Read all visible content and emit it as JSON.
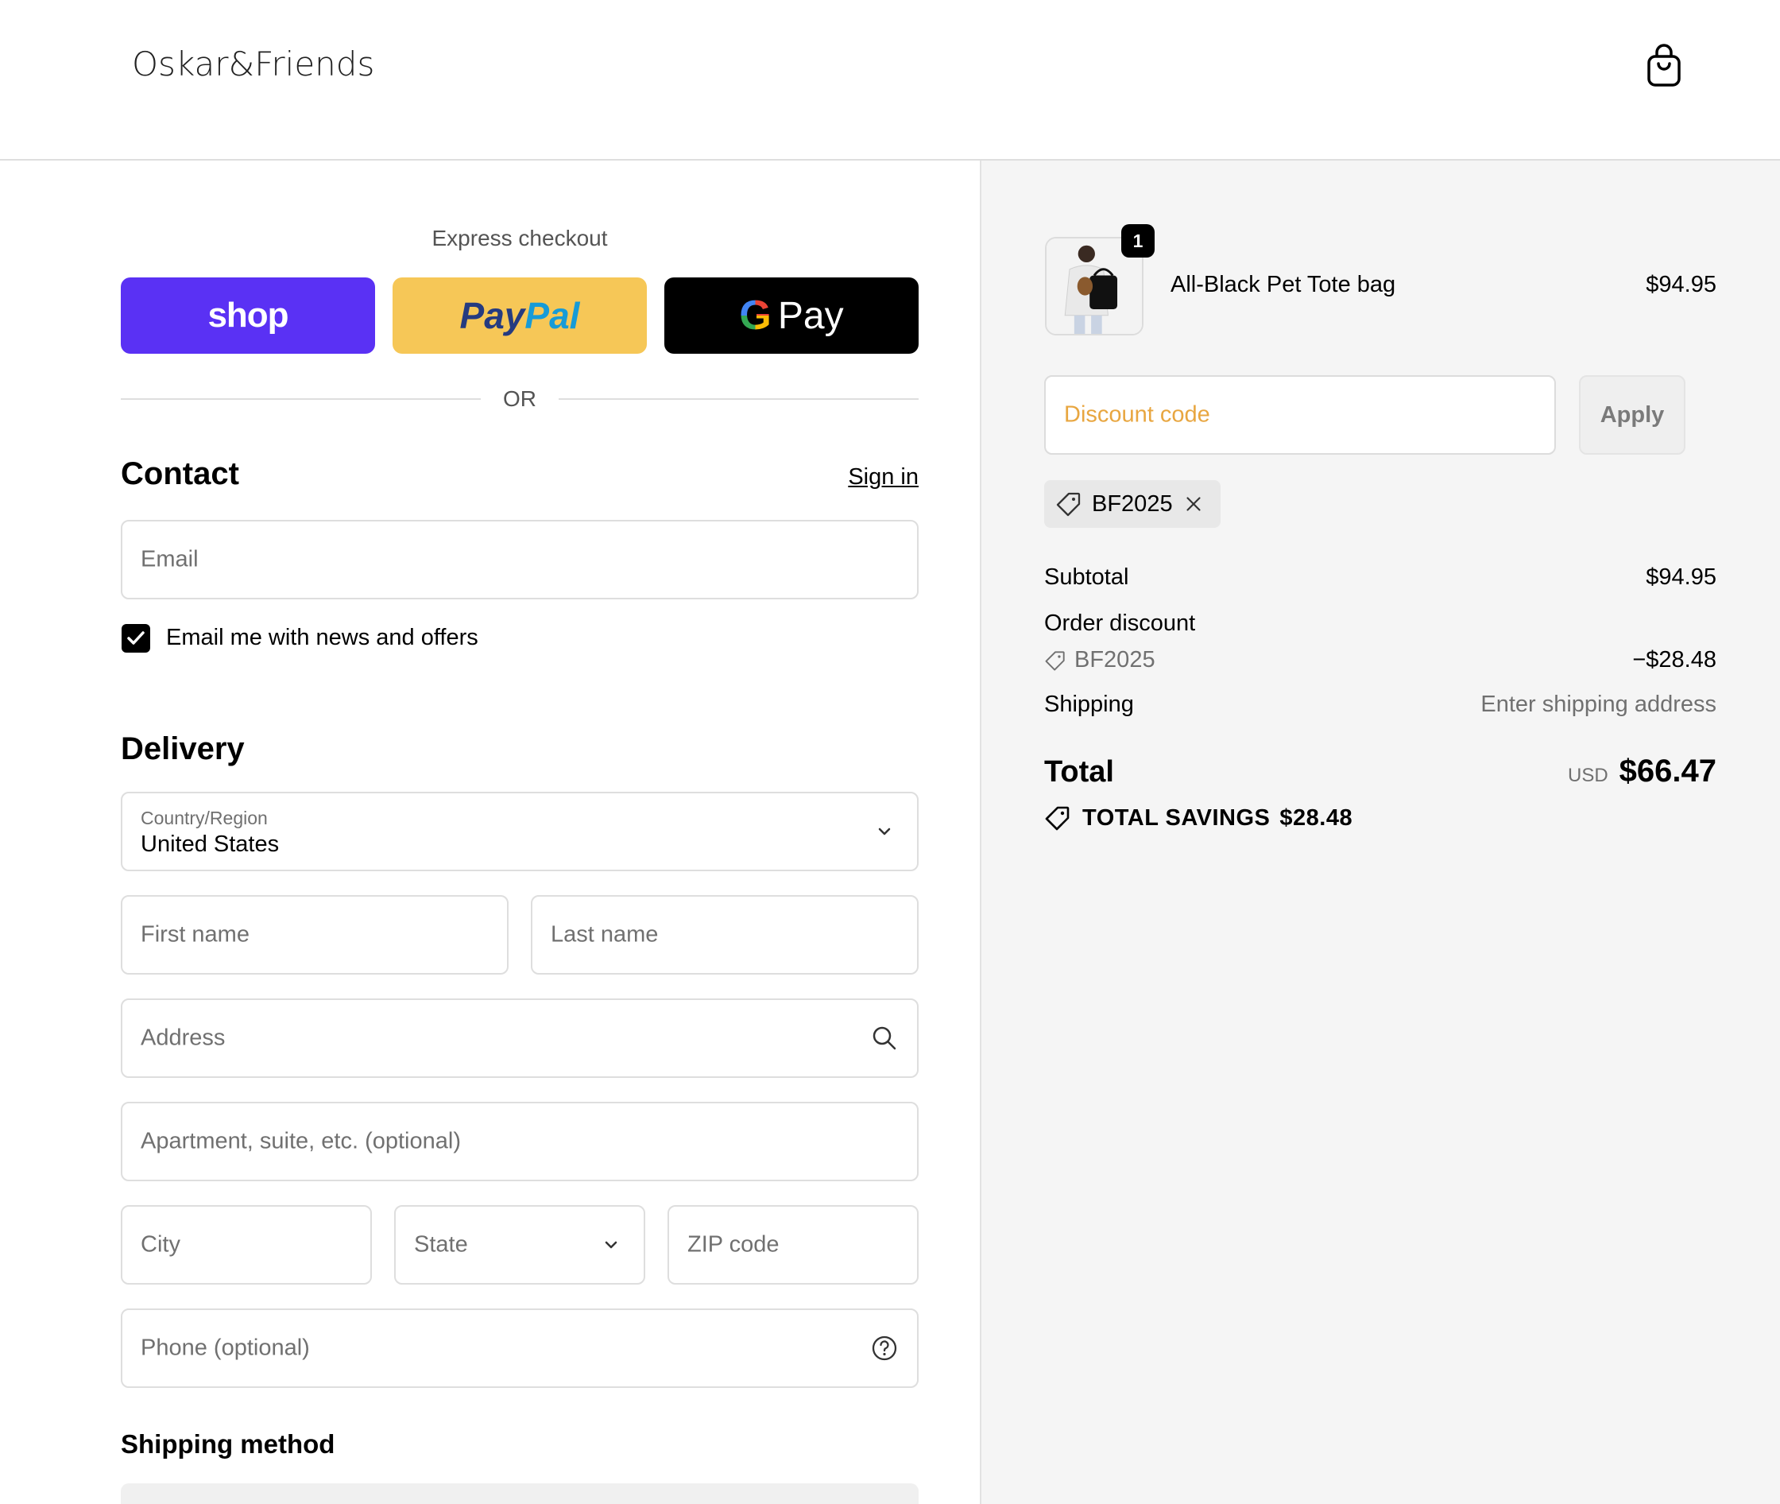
{
  "header": {
    "logo_text": "Oskar&Friends",
    "cart_icon": "shopping-bag-icon"
  },
  "express": {
    "title": "Express checkout",
    "shop_label": "shop",
    "paypal_label_1": "Pay",
    "paypal_label_2": "Pal",
    "gpay_g": "G",
    "gpay_label": "Pay",
    "or_label": "OR"
  },
  "contact": {
    "heading": "Contact",
    "sign_in": "Sign in",
    "email_placeholder": "Email",
    "news_label": "Email me with news and offers",
    "news_checked": true
  },
  "delivery": {
    "heading": "Delivery",
    "country_label": "Country/Region",
    "country_value": "United States",
    "first_name": "First name",
    "last_name": "Last name",
    "address": "Address",
    "apartment": "Apartment, suite, etc. (optional)",
    "city": "City",
    "state": "State",
    "zip": "ZIP code",
    "phone": "Phone (optional)"
  },
  "shipping_method": {
    "heading": "Shipping method"
  },
  "summary": {
    "product": {
      "name": "All-Black Pet Tote bag",
      "price": "$94.95",
      "quantity": "1"
    },
    "discount_placeholder": "Discount code",
    "apply_label": "Apply",
    "applied_code": "BF2025",
    "subtotal_label": "Subtotal",
    "subtotal_value": "$94.95",
    "order_discount_label": "Order discount",
    "order_discount_code": "BF2025",
    "order_discount_value": "−$28.48",
    "shipping_label": "Shipping",
    "shipping_value": "Enter shipping address",
    "total_label": "Total",
    "total_currency": "USD",
    "total_value": "$66.47",
    "savings_label": "TOTAL SAVINGS",
    "savings_value": "$28.48"
  },
  "colors": {
    "shop_pay": "#5a31f4",
    "paypal": "#f6c757",
    "gpay": "#000000",
    "discount_placeholder": "#e8a640"
  }
}
